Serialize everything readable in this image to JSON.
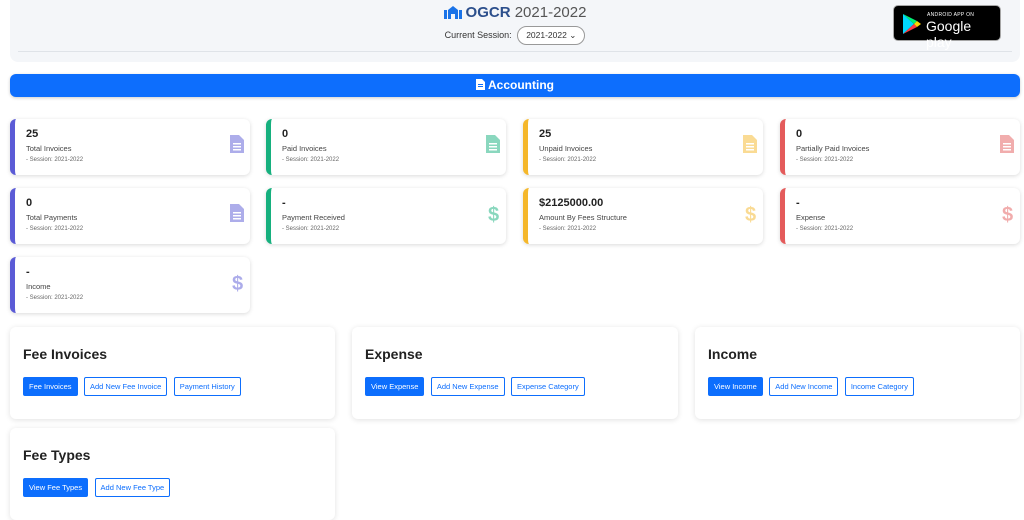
{
  "header": {
    "brand_name": "OGCR",
    "brand_year": "2021-2022",
    "session_label": "Current Session:",
    "session_value": "2021-2022",
    "store_badge_small": "ANDROID APP ON",
    "store_badge_big": "Google play"
  },
  "section_title": "Accounting",
  "stats": [
    {
      "value": "25",
      "label": "Total Invoices",
      "session": "- Session: 2021-2022",
      "icon": "invoice-icon",
      "color": "#5b5bd6"
    },
    {
      "value": "0",
      "label": "Paid Invoices",
      "session": "- Session: 2021-2022",
      "icon": "invoice-icon",
      "color": "#16b07e"
    },
    {
      "value": "25",
      "label": "Unpaid Invoices",
      "session": "- Session: 2021-2022",
      "icon": "invoice-icon",
      "color": "#f5b72a"
    },
    {
      "value": "0",
      "label": "Partially Paid Invoices",
      "session": "- Session: 2021-2022",
      "icon": "invoice-icon",
      "color": "#e45b5b"
    },
    {
      "value": "0",
      "label": "Total Payments",
      "session": "- Session: 2021-2022",
      "icon": "invoice-icon",
      "color": "#5b5bd6"
    },
    {
      "value": "-",
      "label": "Payment Received",
      "session": "- Session: 2021-2022",
      "icon": "dollar-icon",
      "color": "#16b07e"
    },
    {
      "value": "$2125000.00",
      "label": "Amount By Fees Structure",
      "session": "- Session: 2021-2022",
      "icon": "dollar-icon",
      "color": "#f5b72a"
    },
    {
      "value": "-",
      "label": "Expense",
      "session": "- Session: 2021-2022",
      "icon": "dollar-icon",
      "color": "#e45b5b"
    },
    {
      "value": "-",
      "label": "Income",
      "session": "- Session: 2021-2022",
      "icon": "dollar-icon",
      "color": "#5b5bd6"
    }
  ],
  "cards": {
    "fee_invoices": {
      "title": "Fee Invoices",
      "buttons": [
        "Fee Invoices",
        "Add New Fee Invoice",
        "Payment History"
      ]
    },
    "expense": {
      "title": "Expense",
      "buttons": [
        "View Expense",
        "Add New Expense",
        "Expense Category"
      ]
    },
    "income": {
      "title": "Income",
      "buttons": [
        "View Income",
        "Add New Income",
        "Income Category"
      ]
    },
    "fee_types": {
      "title": "Fee Types",
      "buttons": [
        "View Fee Types",
        "Add New Fee Type"
      ]
    }
  }
}
